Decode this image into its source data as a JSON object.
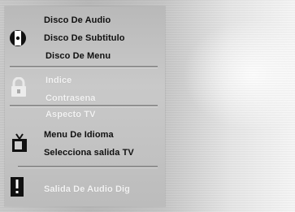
{
  "menu": {
    "groups": [
      {
        "icon": "disc-icon",
        "items": [
          {
            "label": "Disco De Audio"
          },
          {
            "label": "Disco De Subtitulo"
          },
          {
            "label": "Disco De Menu"
          }
        ]
      },
      {
        "icon": "lock-icon",
        "items": [
          {
            "label": "Indice"
          },
          {
            "label": "Contrasena"
          }
        ]
      },
      {
        "icon": "tv-icon",
        "items": [
          {
            "label": "Aspecto TV"
          },
          {
            "label": "Menu De Idioma"
          },
          {
            "label": "Selecciona salida TV"
          }
        ]
      },
      {
        "icon": "warning-icon",
        "items": [
          {
            "label": "Salida De Audio Dig"
          }
        ]
      }
    ]
  }
}
